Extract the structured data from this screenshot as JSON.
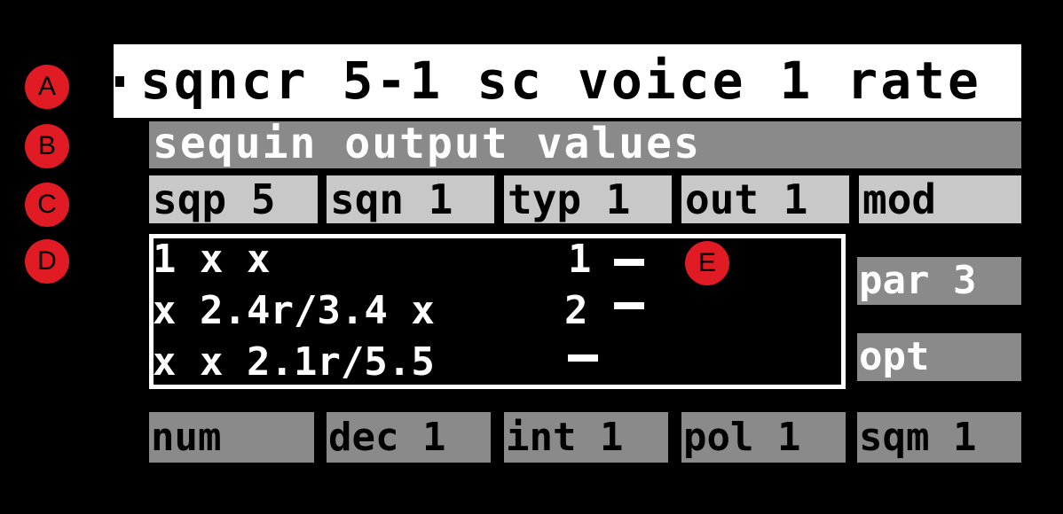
{
  "markers": [
    "A",
    "B",
    "C",
    "D",
    "E"
  ],
  "title": "sqncr 5-1 sc voice 1 rate",
  "subtitle": "sequin output values",
  "tabs": [
    "sqp 5",
    "sqn 1",
    "typ 1",
    "out 1",
    "mod"
  ],
  "sequence": {
    "lines": [
      "1 x x",
      "x 2.4r/3.4 x",
      "x x 2.1r/5.5"
    ],
    "step_numbers": [
      "1",
      "2"
    ]
  },
  "side_buttons": [
    "par 3",
    "opt"
  ],
  "bottom_buttons": [
    "num",
    "dec 1",
    "int 1",
    "pol 1",
    "sqm 1"
  ]
}
